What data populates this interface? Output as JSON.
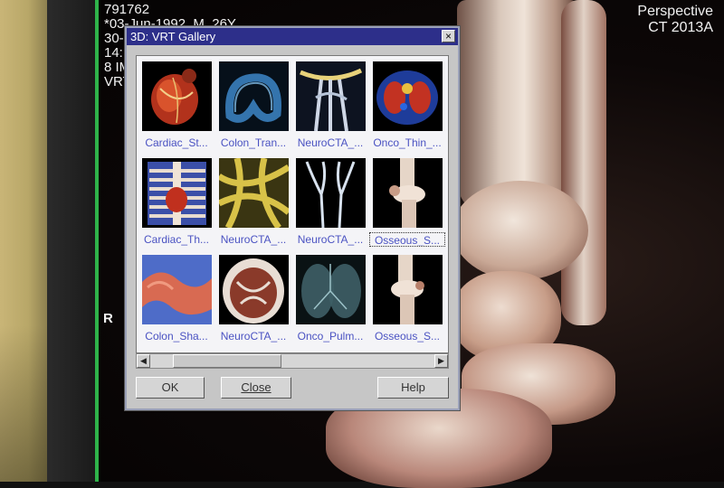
{
  "overlay": {
    "patient_id": "791762",
    "birth_line": "*03-Jun-1992, M, 26Y",
    "line3": "30-",
    "line4": "14:",
    "line5": "8 IM",
    "line6": "VRT",
    "view": "Perspective",
    "modality": "CT 2013A",
    "orientation": "R"
  },
  "dialog": {
    "title": "3D: VRT Gallery",
    "close_glyph": "×",
    "items": [
      {
        "label": "Cardiac_St..."
      },
      {
        "label": "Colon_Tran..."
      },
      {
        "label": "NeuroCTA_..."
      },
      {
        "label": "Onco_Thin_..."
      },
      {
        "label": "Cardiac_Th..."
      },
      {
        "label": "NeuroCTA_..."
      },
      {
        "label": "NeuroCTA_..."
      },
      {
        "label": "Osseous_S..."
      },
      {
        "label": "Colon_Sha..."
      },
      {
        "label": "NeuroCTA_..."
      },
      {
        "label": "Onco_Pulm..."
      },
      {
        "label": "Osseous_S..."
      }
    ],
    "selected_index": 7,
    "buttons": {
      "ok": "OK",
      "close": "Close",
      "help": "Help"
    },
    "scroll_left_glyph": "◀",
    "scroll_right_glyph": "▶"
  },
  "colors": {
    "titlebar": "#2d2f8a",
    "caption": "#4a52c2",
    "monitor_edge": "#2fb34a"
  }
}
